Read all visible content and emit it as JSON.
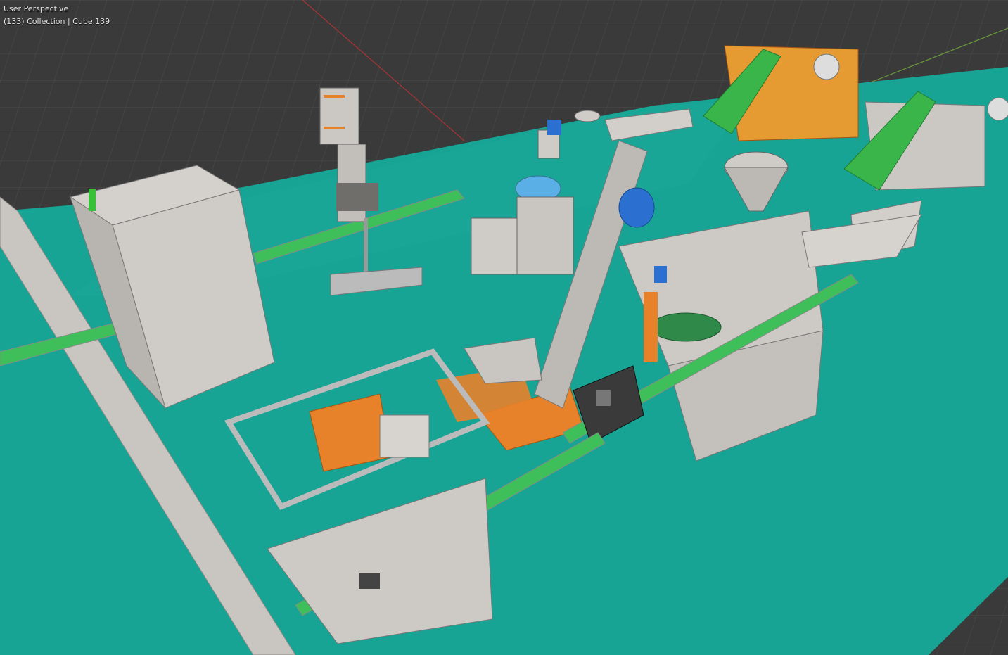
{
  "viewport": {
    "view_name": "User Perspective",
    "collection_info": "(133) Collection | Cube.139"
  },
  "scene": {
    "floor_color": "#17a495",
    "grid_bg_color": "#3a3a3a",
    "grid_line_color": "#4a4a4a",
    "machine_color": "#cbc8c3",
    "machine_dark": "#8f8c88",
    "orange_color": "#e8822a",
    "green_color": "#39b54a",
    "blue_color": "#2b6fd0"
  }
}
